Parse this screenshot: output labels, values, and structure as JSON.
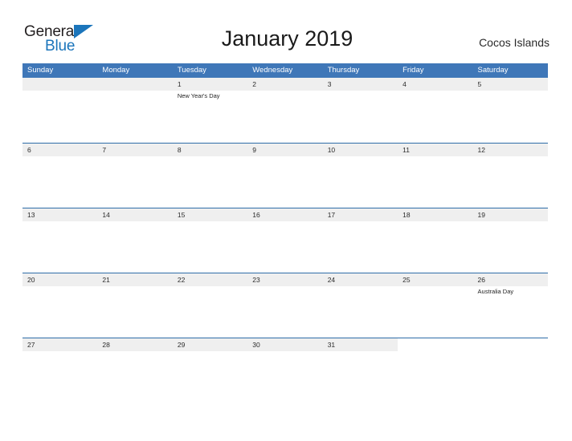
{
  "brand": {
    "name_part1": "General",
    "name_part2": "Blue",
    "logo_icon": "blue-flag-triangle-icon",
    "color_dark": "#231f20",
    "color_blue": "#1b75bb"
  },
  "header": {
    "title": "January 2019",
    "region": "Cocos Islands"
  },
  "theme": {
    "header_blue": "#3f77b8",
    "row_divider_blue": "#2e6da8",
    "date_band_gray": "#efefef",
    "text_dark": "#2b2b2b"
  },
  "calendar": {
    "month": "January",
    "year": "2019",
    "weekdays": [
      "Sunday",
      "Monday",
      "Tuesday",
      "Wednesday",
      "Thursday",
      "Friday",
      "Saturday"
    ],
    "weeks": [
      {
        "days": [
          {
            "num": "",
            "event": ""
          },
          {
            "num": "",
            "event": ""
          },
          {
            "num": "1",
            "event": "New Year's Day"
          },
          {
            "num": "2",
            "event": ""
          },
          {
            "num": "3",
            "event": ""
          },
          {
            "num": "4",
            "event": ""
          },
          {
            "num": "5",
            "event": ""
          }
        ]
      },
      {
        "days": [
          {
            "num": "6",
            "event": ""
          },
          {
            "num": "7",
            "event": ""
          },
          {
            "num": "8",
            "event": ""
          },
          {
            "num": "9",
            "event": ""
          },
          {
            "num": "10",
            "event": ""
          },
          {
            "num": "11",
            "event": ""
          },
          {
            "num": "12",
            "event": ""
          }
        ]
      },
      {
        "days": [
          {
            "num": "13",
            "event": ""
          },
          {
            "num": "14",
            "event": ""
          },
          {
            "num": "15",
            "event": ""
          },
          {
            "num": "16",
            "event": ""
          },
          {
            "num": "17",
            "event": ""
          },
          {
            "num": "18",
            "event": ""
          },
          {
            "num": "19",
            "event": ""
          }
        ]
      },
      {
        "days": [
          {
            "num": "20",
            "event": ""
          },
          {
            "num": "21",
            "event": ""
          },
          {
            "num": "22",
            "event": ""
          },
          {
            "num": "23",
            "event": ""
          },
          {
            "num": "24",
            "event": ""
          },
          {
            "num": "25",
            "event": ""
          },
          {
            "num": "26",
            "event": "Australia Day"
          }
        ]
      },
      {
        "days": [
          {
            "num": "27",
            "event": ""
          },
          {
            "num": "28",
            "event": ""
          },
          {
            "num": "29",
            "event": ""
          },
          {
            "num": "30",
            "event": ""
          },
          {
            "num": "31",
            "event": ""
          },
          {
            "num": "",
            "event": ""
          },
          {
            "num": "",
            "event": ""
          }
        ]
      }
    ],
    "holidays": [
      {
        "date": "1",
        "name": "New Year's Day"
      },
      {
        "date": "26",
        "name": "Australia Day"
      }
    ]
  }
}
